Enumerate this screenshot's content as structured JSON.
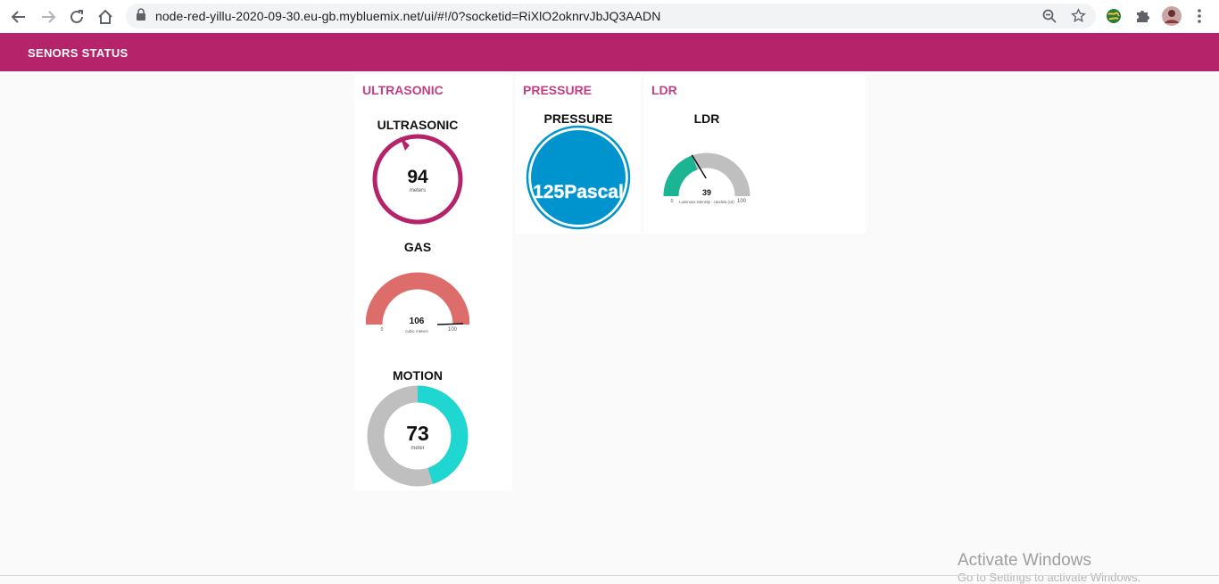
{
  "browser": {
    "url": "node-red-yillu-2020-09-30.eu-gb.mybluemix.net/ui/#!/0?socketid=RiXlO2oknrvJbJQ3AADN"
  },
  "header": {
    "title": "SENORS STATUS"
  },
  "groups": {
    "ultrasonic": "ULTRASONIC",
    "pressure": "PRESSURE",
    "ldr": "LDR"
  },
  "widgets": {
    "ultrasonic": {
      "title": "ULTRASONIC",
      "value": "94",
      "unit": "meters",
      "color": "#b5236a"
    },
    "gas": {
      "title": "GAS",
      "value": "106",
      "unit": "cubic meters",
      "min": "0",
      "max": "100",
      "color": "#dd6d6b"
    },
    "motion": {
      "title": "MOTION",
      "value": "73",
      "unit": "meter",
      "fill_fraction": 0.45,
      "color": "#1fd6d0"
    },
    "pressure": {
      "title": "PRESSURE",
      "value": "125Pascal",
      "color": "#0094ce"
    },
    "ldr": {
      "title": "LDR",
      "value": "39",
      "unit": "Luminous intensity - candela (cd)",
      "min": "0",
      "max": "100",
      "fraction": 0.39,
      "color": "#1bb594"
    }
  },
  "watermark": {
    "line1": "Activate Windows",
    "line2": "Go to Settings to activate Windows."
  }
}
